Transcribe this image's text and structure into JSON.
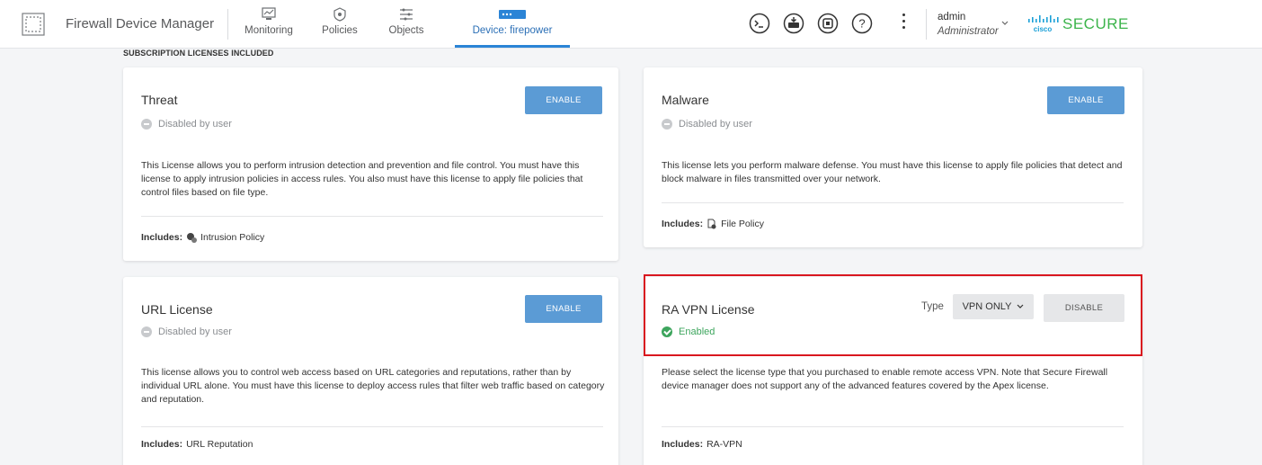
{
  "header": {
    "app_title": "Firewall Device Manager",
    "nav": [
      {
        "label": "Monitoring",
        "icon": "monitoring-icon"
      },
      {
        "label": "Policies",
        "icon": "policies-icon"
      },
      {
        "label": "Objects",
        "icon": "objects-icon"
      },
      {
        "label": "Device: firepower",
        "icon": "device-icon"
      }
    ],
    "toolbar_icons": [
      "cli-console-icon",
      "deploy-icon",
      "api-explorer-icon",
      "help-icon",
      "more-options-icon"
    ],
    "user": {
      "name": "admin",
      "role": "Administrator"
    },
    "brand": {
      "cisco": "cisco",
      "secure": "SECURE"
    }
  },
  "section_header": "SUBSCRIPTION LICENSES INCLUDED",
  "cards": {
    "threat": {
      "title": "Threat",
      "status": "Disabled by user",
      "button": "ENABLE",
      "description": "This License allows you to perform intrusion detection and prevention and file control. You must have this license to apply intrusion policies in access rules. You also must have this license to apply file policies that control files based on file type.",
      "includes_label": "Includes:",
      "includes": "Intrusion Policy"
    },
    "malware": {
      "title": "Malware",
      "status": "Disabled by user",
      "button": "ENABLE",
      "description": "This license lets you perform malware defense. You must have this license to apply file policies that detect and block malware in files transmitted over your network.",
      "includes_label": "Includes:",
      "includes": "File Policy"
    },
    "url": {
      "title": "URL License",
      "status": "Disabled by user",
      "button": "ENABLE",
      "description": "This license allows you to control web access based on URL categories and reputations, rather than by individual URL alone. You must have this license to deploy access rules that filter web traffic based on category and reputation.",
      "includes_label": "Includes:",
      "includes": "URL Reputation"
    },
    "ravpn": {
      "title": "RA VPN License",
      "status": "Enabled",
      "type_label": "Type",
      "type_value": "VPN ONLY",
      "button": "DISABLE",
      "description": "Please select the license type that you purchased to enable remote access VPN. Note that Secure Firewall device manager does not support any of the advanced features covered by the Apex license.",
      "includes_label": "Includes:",
      "includes": "RA-VPN"
    }
  },
  "colors": {
    "accent": "#2b84d6",
    "enable_button": "#5b9bd5",
    "enabled_green": "#3da55d",
    "highlight_red": "#d9171f",
    "secure_green": "#3cb44b"
  }
}
